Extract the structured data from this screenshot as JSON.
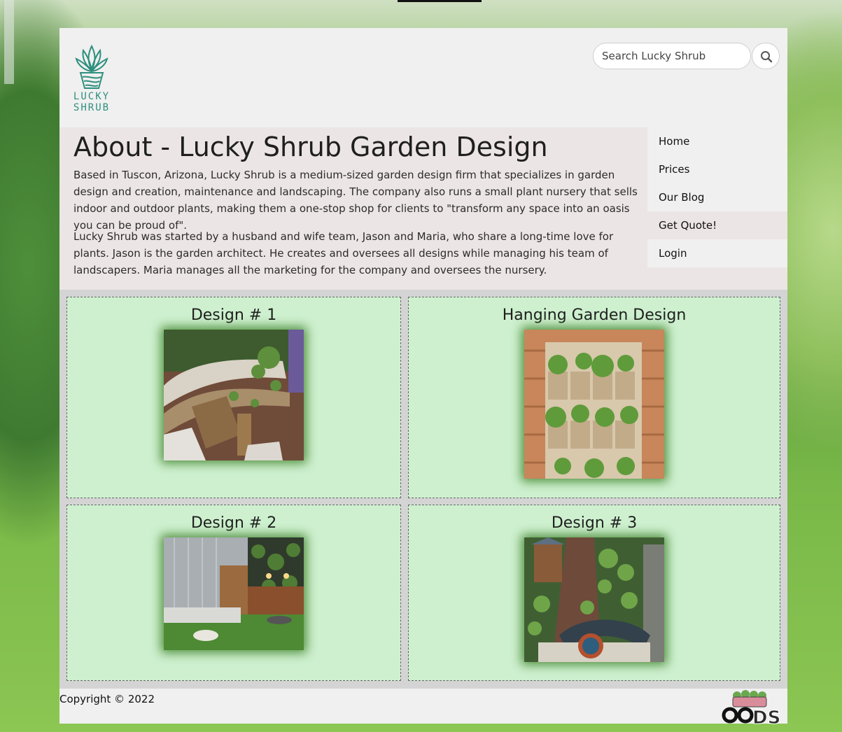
{
  "header": {
    "logo_text_line1": "LUCKY",
    "logo_text_line2": "SHRUB",
    "search_placeholder": "Search Lucky Shrub"
  },
  "about": {
    "title": "About - Lucky Shrub Garden Design",
    "paragraph1": "Based in Tuscon, Arizona, Lucky Shrub is a medium-sized garden design firm that specializes in garden design and creation, maintenance and landscaping. The company also runs a small plant nursery that sells indoor and outdoor plants, making them a one-stop shop for clients to \"transform any space into an oasis you can be proud of\".",
    "paragraph2": "Lucky Shrub was started by a husband and wife team, Jason and Maria, who share a long-time love for plants. Jason is the garden architect. He creates and oversees all designs while managing his team of landscapers. Maria manages all the marketing for the company and oversees the nursery."
  },
  "nav": {
    "items": [
      {
        "label": "Home"
      },
      {
        "label": "Prices"
      },
      {
        "label": "Our Blog"
      },
      {
        "label": "Get Quote!"
      },
      {
        "label": "Login"
      }
    ]
  },
  "designs": [
    {
      "title": "Design # 1"
    },
    {
      "title": "Hanging Garden Design"
    },
    {
      "title": "Design # 2"
    },
    {
      "title": "Design # 3"
    }
  ],
  "footer": {
    "copyright": "Copyright © 2022",
    "badge_text": "DS"
  }
}
